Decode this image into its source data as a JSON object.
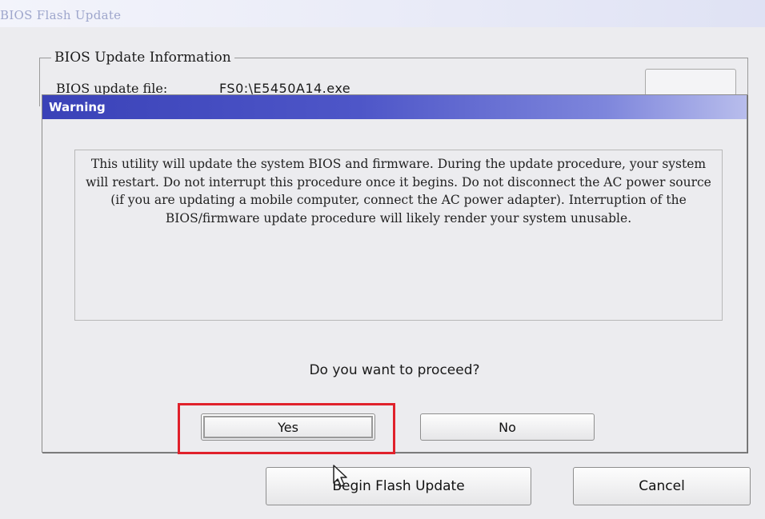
{
  "window": {
    "title": "BIOS Flash Update"
  },
  "info": {
    "legend": "BIOS Update Information",
    "file_label": "BIOS update file:",
    "file_value": "FS0:\\E5450A14.exe"
  },
  "warning": {
    "title": "Warning",
    "message": "This utility will update the system BIOS and firmware. During the update procedure, your system will restart. Do not interrupt this procedure once it begins. Do not disconnect the AC power source (if you are updating a mobile computer, connect the AC power adapter). Interruption of the BIOS/firmware update procedure will likely render your system unusable.",
    "question": "Do you want to proceed?",
    "yes_label": "Yes",
    "no_label": "No"
  },
  "footer": {
    "begin_label": "Begin Flash Update",
    "cancel_label": "Cancel"
  },
  "colors": {
    "warning_header": "#3a42b8",
    "highlight": "#e0212b"
  },
  "icons": {
    "cursor": "mouse-pointer-icon"
  }
}
